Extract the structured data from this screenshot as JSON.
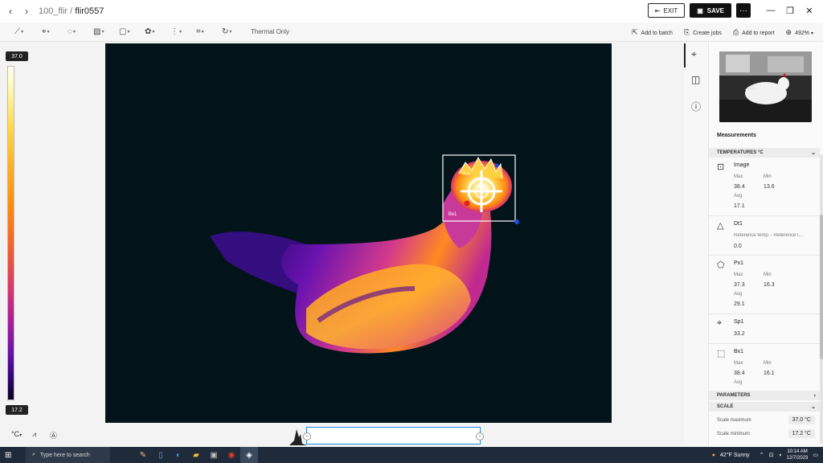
{
  "titlebar": {
    "back_icon": "chevron-left-icon",
    "forward_icon": "chevron-right-icon",
    "breadcrumb_folder": "100_flir",
    "breadcrumb_sep": " / ",
    "breadcrumb_file": "flir0557",
    "exit_label": "EXIT",
    "save_label": "SAVE",
    "more_label": "···",
    "min_label": "—",
    "restore_label": "❐",
    "close_label": "✕"
  },
  "toolbar": {
    "tools": [
      "measure-line-icon",
      "spot-icon",
      "ellipse-icon",
      "image-adjust-icon",
      "box-icon",
      "palette-icon",
      "align-icon",
      "crop-icon",
      "rotate-icon"
    ],
    "thermal_only": "Thermal Only",
    "add_to_batch": "Add to batch",
    "create_jobs": "Create jobs",
    "add_to_report": "Add to report",
    "zoom": "492%"
  },
  "scale": {
    "max_label": "37.0",
    "min_label": "17.2"
  },
  "overlay": {
    "box_label": "Bx1",
    "spot_label": "Sp1",
    "poly_label": "Px1"
  },
  "bottombar": {
    "unit_label": "°C",
    "histogram_icon": "chart-icon",
    "auto_icon": "auto-adjust-icon"
  },
  "rightpanel": {
    "measurements_title": "Measurements",
    "temps_header": "TEMPERATURES °C",
    "items": [
      {
        "name": "Image",
        "icon": "image-icon",
        "max_label": "Max",
        "max": "38.4",
        "min_label": "Min",
        "min": "13.6",
        "avg_label": "Avg",
        "avg": "17.1"
      },
      {
        "name": "Dt1",
        "icon": "delta-icon",
        "desc": "Reference temp. - Reference t...",
        "value": "0.0"
      },
      {
        "name": "Px1",
        "icon": "polygon-icon",
        "max_label": "Max",
        "max": "37.3",
        "min_label": "Min",
        "min": "16.3",
        "avg_label": "Avg",
        "avg": "29.1"
      },
      {
        "name": "Sp1",
        "icon": "spot-icon",
        "value": "33.2"
      },
      {
        "name": "Bx1",
        "icon": "box-icon",
        "max_label": "Max",
        "max": "38.4",
        "min_label": "Min",
        "min": "16.1",
        "avg_label": "Avg"
      }
    ],
    "parameters_header": "PARAMETERS",
    "scale_header": "SCALE",
    "scale_max_label": "Scale maximum",
    "scale_max_value": "37.0 °C",
    "scale_min_label": "Scale minimum",
    "scale_min_value": "17.2 °C"
  },
  "taskbar": {
    "search_placeholder": "Type here to search",
    "weather": "42°F  Sunny",
    "time": "10:14 AM",
    "date": "12/7/2023"
  }
}
